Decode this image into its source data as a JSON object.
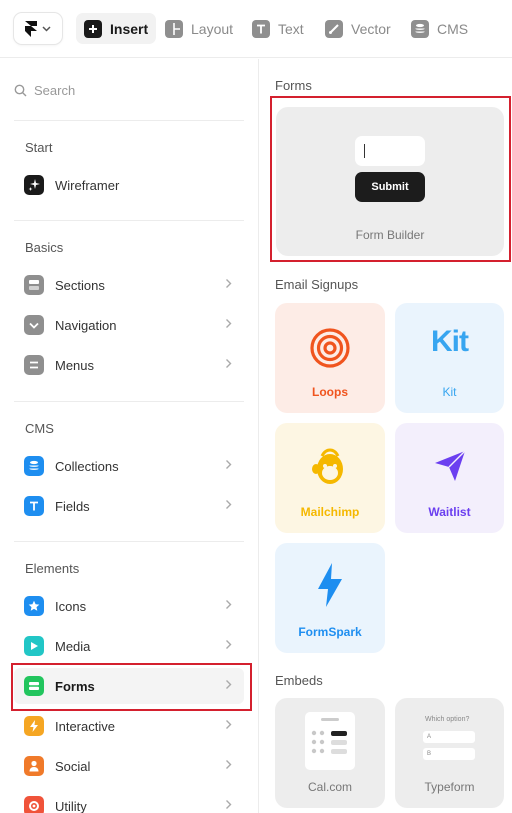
{
  "toolbar": {
    "tabs": [
      {
        "label": "Insert",
        "icon": "plus-icon",
        "active": true
      },
      {
        "label": "Layout",
        "icon": "layout-icon",
        "active": false
      },
      {
        "label": "Text",
        "icon": "text-icon",
        "active": false
      },
      {
        "label": "Vector",
        "icon": "pen-icon",
        "active": false
      },
      {
        "label": "CMS",
        "icon": "database-icon",
        "active": false
      }
    ]
  },
  "sidebar": {
    "search_placeholder": "Search",
    "sections": [
      {
        "title": "Start",
        "items": [
          {
            "label": "Wireframer",
            "icon": "sparkle-icon",
            "color": "#1a1a1a"
          }
        ]
      },
      {
        "title": "Basics",
        "items": [
          {
            "label": "Sections",
            "icon": "sections-icon",
            "color": "#8f8f8f"
          },
          {
            "label": "Navigation",
            "icon": "navigation-icon",
            "color": "#8f8f8f"
          },
          {
            "label": "Menus",
            "icon": "menu-icon",
            "color": "#8f8f8f"
          }
        ]
      },
      {
        "title": "CMS",
        "items": [
          {
            "label": "Collections",
            "icon": "database-icon",
            "color": "#1e8ef0"
          },
          {
            "label": "Fields",
            "icon": "text-field-icon",
            "color": "#1e8ef0"
          }
        ]
      },
      {
        "title": "Elements",
        "items": [
          {
            "label": "Icons",
            "icon": "star-icon",
            "color": "#1e8ef0"
          },
          {
            "label": "Media",
            "icon": "play-icon",
            "color": "#22c6c6"
          },
          {
            "label": "Forms",
            "icon": "form-icon",
            "color": "#22c55e",
            "selected": true
          },
          {
            "label": "Interactive",
            "icon": "bolt-icon",
            "color": "#f5a623"
          },
          {
            "label": "Social",
            "icon": "person-icon",
            "color": "#f07a2a"
          },
          {
            "label": "Utility",
            "icon": "utility-icon",
            "color": "#f0533a"
          }
        ]
      }
    ]
  },
  "panel": {
    "forms_heading": "Forms",
    "form_builder": {
      "label": "Form Builder",
      "button_label": "Submit"
    },
    "email_heading": "Email Signups",
    "email_cards": [
      {
        "label": "Loops",
        "color": "#f0541e",
        "bg": "#fdece6"
      },
      {
        "label": "Kit",
        "color": "#37a5f0",
        "bg": "#eaf4fd",
        "logo_text": "Kit"
      },
      {
        "label": "Mailchimp",
        "color": "#f5b800",
        "bg": "#fdf6e3"
      },
      {
        "label": "Waitlist",
        "color": "#6b3ff0",
        "bg": "#f3effc"
      },
      {
        "label": "FormSpark",
        "color": "#1e8ef0",
        "bg": "#eaf4fd"
      }
    ],
    "embeds_heading": "Embeds",
    "embed_cards": [
      {
        "label": "Cal.com"
      },
      {
        "label": "Typeform",
        "question": "Which option?",
        "options": [
          "A",
          "B"
        ]
      }
    ]
  }
}
